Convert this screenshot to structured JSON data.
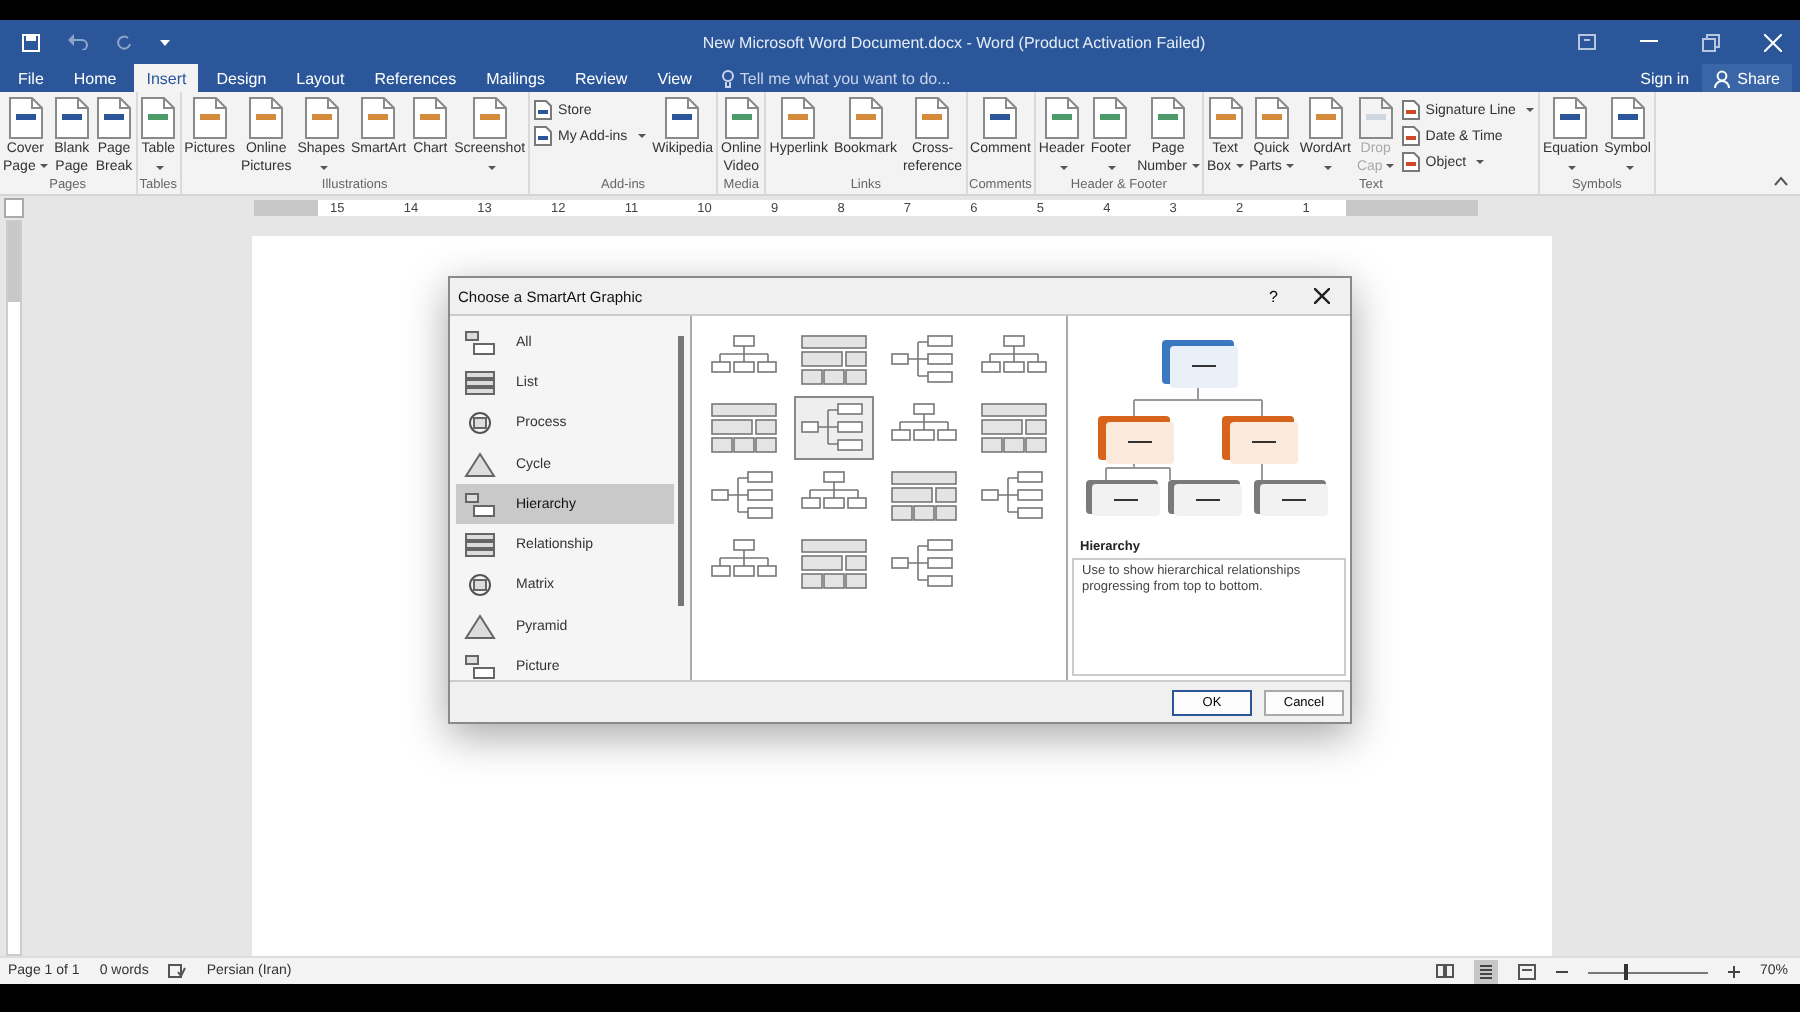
{
  "window": {
    "title": "New Microsoft Word Document.docx - Word (Product Activation Failed)"
  },
  "tabs": [
    {
      "label": "File",
      "selected": false
    },
    {
      "label": "Home",
      "selected": false
    },
    {
      "label": "Insert",
      "selected": true
    },
    {
      "label": "Design",
      "selected": false
    },
    {
      "label": "Layout",
      "selected": false
    },
    {
      "label": "References",
      "selected": false
    },
    {
      "label": "Mailings",
      "selected": false
    },
    {
      "label": "Review",
      "selected": false
    },
    {
      "label": "View",
      "selected": false
    }
  ],
  "tell_me": {
    "placeholder": "Tell me what you want to do..."
  },
  "account": {
    "sign_in": "Sign in",
    "share": "Share"
  },
  "ribbon": [
    {
      "name": "Pages",
      "items": [
        {
          "kind": "large",
          "lines": [
            "Cover",
            "Page"
          ],
          "dropdown": true
        },
        {
          "kind": "large",
          "lines": [
            "Blank",
            "Page"
          ],
          "dropdown": false
        },
        {
          "kind": "large",
          "lines": [
            "Page",
            "Break"
          ],
          "dropdown": false
        }
      ]
    },
    {
      "name": "Tables",
      "items": [
        {
          "kind": "large",
          "lines": [
            "Table"
          ],
          "dropdown": true
        }
      ]
    },
    {
      "name": "Illustrations",
      "items": [
        {
          "kind": "large",
          "lines": [
            "Pictures"
          ],
          "dropdown": false
        },
        {
          "kind": "large",
          "lines": [
            "Online",
            "Pictures"
          ],
          "dropdown": false
        },
        {
          "kind": "large",
          "lines": [
            "Shapes"
          ],
          "dropdown": true
        },
        {
          "kind": "large",
          "lines": [
            "SmartArt"
          ],
          "dropdown": false
        },
        {
          "kind": "large",
          "lines": [
            "Chart"
          ],
          "dropdown": false
        },
        {
          "kind": "large",
          "lines": [
            "Screenshot"
          ],
          "dropdown": true
        }
      ]
    },
    {
      "name": "Add-ins",
      "items": [
        {
          "kind": "stack",
          "buttons": [
            {
              "label": "Store",
              "dropdown": false
            },
            {
              "label": "My Add-ins",
              "dropdown": true
            }
          ]
        },
        {
          "kind": "large",
          "lines": [
            "Wikipedia"
          ],
          "dropdown": false
        }
      ]
    },
    {
      "name": "Media",
      "items": [
        {
          "kind": "large",
          "lines": [
            "Online",
            "Video"
          ],
          "dropdown": false
        }
      ]
    },
    {
      "name": "Links",
      "items": [
        {
          "kind": "large",
          "lines": [
            "Hyperlink"
          ],
          "dropdown": false
        },
        {
          "kind": "large",
          "lines": [
            "Bookmark"
          ],
          "dropdown": false
        },
        {
          "kind": "large",
          "lines": [
            "Cross-",
            "reference"
          ],
          "dropdown": false
        }
      ]
    },
    {
      "name": "Comments",
      "items": [
        {
          "kind": "large",
          "lines": [
            "Comment"
          ],
          "dropdown": false
        }
      ]
    },
    {
      "name": "Header & Footer",
      "items": [
        {
          "kind": "large",
          "lines": [
            "Header"
          ],
          "dropdown": true
        },
        {
          "kind": "large",
          "lines": [
            "Footer"
          ],
          "dropdown": true
        },
        {
          "kind": "large",
          "lines": [
            "Page",
            "Number"
          ],
          "dropdown": true
        }
      ]
    },
    {
      "name": "Text",
      "items": [
        {
          "kind": "large",
          "lines": [
            "Text",
            "Box"
          ],
          "dropdown": true,
          "disabled": false
        },
        {
          "kind": "large",
          "lines": [
            "Quick",
            "Parts"
          ],
          "dropdown": true,
          "disabled": false
        },
        {
          "kind": "large",
          "lines": [
            "WordArt"
          ],
          "dropdown": true,
          "disabled": false
        },
        {
          "kind": "large",
          "lines": [
            "Drop",
            "Cap"
          ],
          "dropdown": true,
          "disabled": true
        },
        {
          "kind": "stack",
          "buttons": [
            {
              "label": "Signature Line",
              "dropdown": true
            },
            {
              "label": "Date & Time",
              "dropdown": false
            },
            {
              "label": "Object",
              "dropdown": true
            }
          ]
        }
      ]
    },
    {
      "name": "Symbols",
      "items": [
        {
          "kind": "large",
          "lines": [
            "Equation"
          ],
          "dropdown": true
        },
        {
          "kind": "large",
          "lines": [
            "Symbol"
          ],
          "dropdown": true
        }
      ]
    }
  ],
  "ruler": {
    "numbers": [
      "15",
      "14",
      "13",
      "12",
      "11",
      "10",
      "9",
      "8",
      "7",
      "6",
      "5",
      "4",
      "3",
      "2",
      "1"
    ]
  },
  "dialog": {
    "title": "Choose a SmartArt Graphic",
    "help": "?",
    "categories": [
      {
        "label": "All",
        "selected": false
      },
      {
        "label": "List",
        "selected": false
      },
      {
        "label": "Process",
        "selected": false
      },
      {
        "label": "Cycle",
        "selected": false
      },
      {
        "label": "Hierarchy",
        "selected": true
      },
      {
        "label": "Relationship",
        "selected": false
      },
      {
        "label": "Matrix",
        "selected": false
      },
      {
        "label": "Pyramid",
        "selected": false
      },
      {
        "label": "Picture",
        "selected": false
      }
    ],
    "layouts": [
      {
        "selected": false
      },
      {
        "selected": false
      },
      {
        "selected": false
      },
      {
        "selected": false
      },
      {
        "selected": false
      },
      {
        "selected": true
      },
      {
        "selected": false
      },
      {
        "selected": false
      },
      {
        "selected": false
      },
      {
        "selected": false
      },
      {
        "selected": false
      },
      {
        "selected": false
      },
      {
        "selected": false
      },
      {
        "selected": false
      },
      {
        "selected": false
      }
    ],
    "preview_title": "Hierarchy",
    "description": "Use to show hierarchical relationships progressing from top to bottom.",
    "buttons": [
      "OK",
      "Cancel"
    ]
  },
  "status_bar": {
    "page": "Page 1 of 1",
    "words": "0 words",
    "language": "Persian (Iran)",
    "zoom": "70%",
    "level": 0.32
  }
}
